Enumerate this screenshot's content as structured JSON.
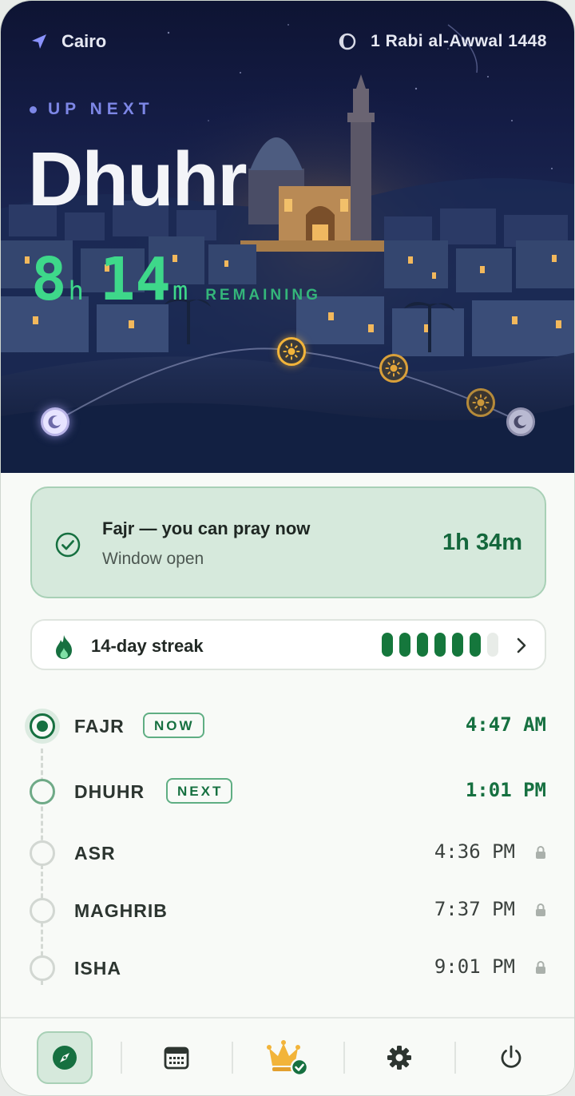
{
  "header": {
    "location": "Cairo",
    "hijri_date": "1 Rabi al-Awwal 1448"
  },
  "hero": {
    "label": "UP NEXT",
    "prayer": "Dhuhr",
    "hours": "8",
    "hours_unit": "h",
    "minutes": "14",
    "minutes_unit": "m",
    "remaining_label": "REMAINING"
  },
  "window_card": {
    "title": "Fajr — you can pray now",
    "subtitle": "Window open",
    "time_left": "1h 34m"
  },
  "streak": {
    "label": "14-day streak",
    "filled": 6,
    "total": 7
  },
  "prayers": [
    {
      "name": "FAJR",
      "badge": "NOW",
      "time": "4:47 AM",
      "state": "current"
    },
    {
      "name": "DHUHR",
      "badge": "NEXT",
      "time": "1:01 PM",
      "state": "next"
    },
    {
      "name": "ASR",
      "badge": "",
      "time": "4:36 PM",
      "state": "locked"
    },
    {
      "name": "MAGHRIB",
      "badge": "",
      "time": "7:37 PM",
      "state": "locked"
    },
    {
      "name": "ISHA",
      "badge": "",
      "time": "9:01 PM",
      "state": "locked"
    }
  ],
  "nav": [
    {
      "icon": "compass-icon",
      "active": true
    },
    {
      "icon": "calendar-icon",
      "active": false
    },
    {
      "icon": "crown-icon",
      "active": false
    },
    {
      "icon": "gear-icon",
      "active": false
    },
    {
      "icon": "power-icon",
      "active": false
    }
  ],
  "colors": {
    "accent_green": "#167040",
    "countdown_green": "#3ed88a",
    "up_next_purple": "#7d87e6",
    "sun_gold": "#f2b43a"
  }
}
